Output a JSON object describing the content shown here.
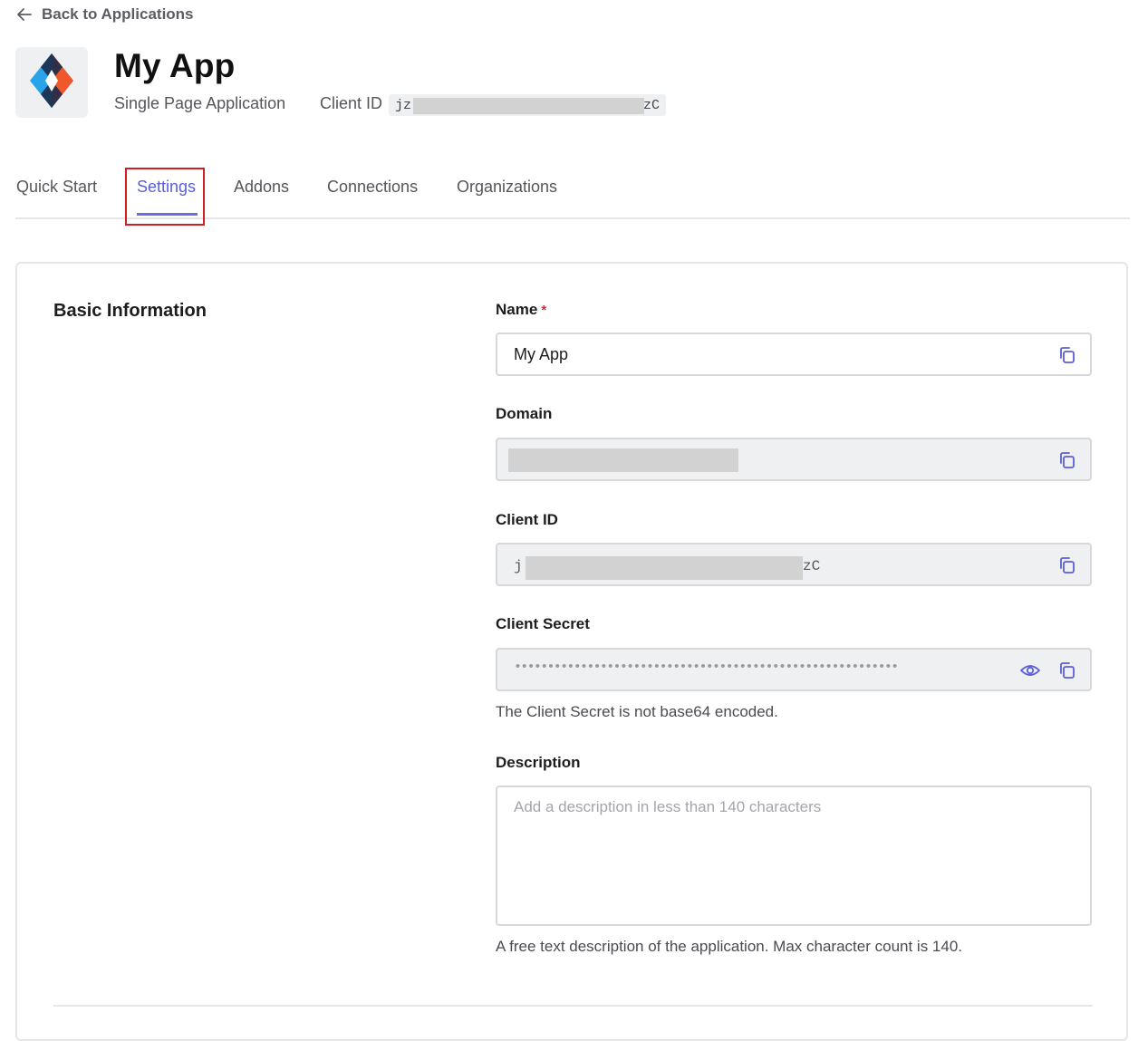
{
  "nav": {
    "back_label": "Back to Applications"
  },
  "app": {
    "name": "My App",
    "type": "Single Page Application",
    "client_id_label": "Client ID",
    "client_id_prefix": "jz",
    "client_id_suffix": "zC"
  },
  "tabs": [
    {
      "label": "Quick Start",
      "active": false
    },
    {
      "label": "Settings",
      "active": true
    },
    {
      "label": "Addons",
      "active": false
    },
    {
      "label": "Connections",
      "active": false
    },
    {
      "label": "Organizations",
      "active": false
    }
  ],
  "basic_info": {
    "section_title": "Basic Information",
    "name": {
      "label": "Name",
      "required_mark": "*",
      "value": "My App"
    },
    "domain": {
      "label": "Domain"
    },
    "client_id": {
      "label": "Client ID",
      "prefix": "j",
      "suffix": "zC"
    },
    "client_secret": {
      "label": "Client Secret",
      "masked_value": "••••••••••••••••••••••••••••••••••••••••••••••••••••••••••",
      "helper": "The Client Secret is not base64 encoded."
    },
    "description": {
      "label": "Description",
      "placeholder": "Add a description in less than 140 characters",
      "helper": "A free text description of the application. Max character count is 140."
    }
  },
  "icons": {
    "back": "arrow-left-icon",
    "copy": "copy-icon",
    "reveal": "eye-icon",
    "logo": "app-logo-icon"
  },
  "colors": {
    "accent": "#5a5ed8",
    "highlight_border": "#d01f24",
    "logo_orange": "#f0572a",
    "logo_blue": "#2aa4e8"
  }
}
